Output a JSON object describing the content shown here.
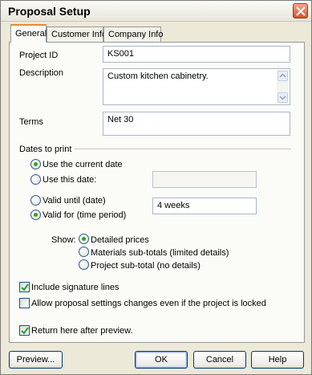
{
  "window": {
    "title": "Proposal Setup"
  },
  "tabs": [
    {
      "label": "General",
      "active": true
    },
    {
      "label": "Customer Info",
      "active": false
    },
    {
      "label": "Company Info",
      "active": false
    }
  ],
  "fields": {
    "project_id": {
      "label": "Project ID",
      "value": "KS001"
    },
    "description": {
      "label": "Description",
      "value": "Custom kitchen cabinetry."
    },
    "terms": {
      "label": "Terms",
      "value": "Net 30"
    }
  },
  "dates_group": {
    "label": "Dates to print",
    "use_current": {
      "label": "Use the current date",
      "selected": true
    },
    "use_this": {
      "label": "Use this date:",
      "selected": false,
      "value": ""
    },
    "valid_until": {
      "label": "Valid until (date)",
      "selected": false
    },
    "valid_for": {
      "label": "Valid for (time period)",
      "selected": true,
      "value": "4 weeks"
    }
  },
  "show": {
    "label": "Show:",
    "options": [
      {
        "label": "Detailed prices",
        "selected": true
      },
      {
        "label": "Materials sub-totals (limited details)",
        "selected": false
      },
      {
        "label": "Project sub-total (no details)",
        "selected": false
      }
    ]
  },
  "checkboxes": {
    "signature_lines": {
      "label": "Include signature lines",
      "checked": true
    },
    "allow_changes": {
      "label": "Allow proposal settings changes even if the project is locked",
      "checked": false
    },
    "return_here": {
      "label": "Return here after preview.",
      "checked": true
    }
  },
  "buttons": {
    "preview": "Preview...",
    "ok": "OK",
    "cancel": "Cancel",
    "help": "Help"
  },
  "colors": {
    "dialog_bg": "#ece9d8",
    "active_tab_accent": "#e68b2c",
    "radio_dot": "#2da22d",
    "close_button": "#d6512e"
  },
  "icons": {
    "close": "close-icon",
    "checkmark": "checkmark-icon",
    "scroll_up": "chevron-up-icon",
    "scroll_down": "chevron-down-icon"
  }
}
